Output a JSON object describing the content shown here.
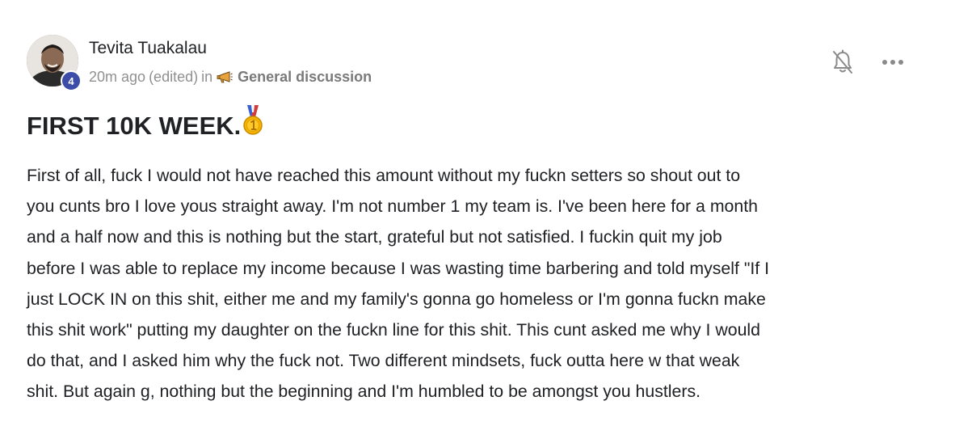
{
  "post": {
    "author": "Tevita Tuakalau",
    "level": "4",
    "time": "20m ago",
    "edited": "(edited)",
    "in_text": "in",
    "category_icon": "megaphone-icon",
    "category": "General discussion",
    "title": "FIRST 10K WEEK.",
    "title_icon": "gold-medal-icon",
    "body_lines": [
      "First of all, fuck I would not have reached this amount without my fuckn setters so shout out to",
      "you cunts bro I love yous straight away. I'm not number 1 my team is. I've been here for a month",
      "and a half now and this is nothing but the start, grateful but not satisfied. I fuckin quit my job",
      "before I was able to replace my income because I was wasting time barbering and told myself \"If I",
      "just LOCK IN on this shit, either me and my family's gonna go homeless or I'm gonna fuckn make",
      "this shit work\" putting my daughter on the fuckn line for this shit. This cunt asked me why I would",
      "do that, and I asked him why the fuck not. Two different mindsets, fuck outta here w that weak",
      "shit. But again g, nothing but the beginning and I'm humbled to be amongst you hustlers."
    ]
  },
  "actions": {
    "notify_icon": "bell-off-icon",
    "more_icon": "more-dots-icon"
  },
  "colors": {
    "badge": "#3b4da8",
    "meta_text": "#909090",
    "text": "#202124"
  }
}
